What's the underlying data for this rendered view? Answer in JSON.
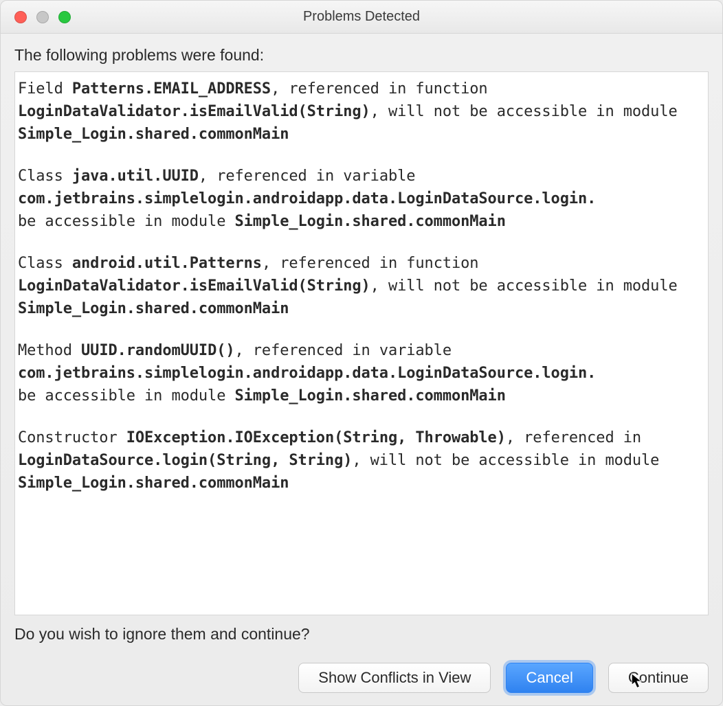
{
  "titlebar": {
    "title": "Problems Detected"
  },
  "intro": "The following problems were found:",
  "problems": [
    {
      "prefix": "Field ",
      "ref": "Patterns.EMAIL_ADDRESS",
      "mid1": ", referenced in function ",
      "func": "LoginDataValidator.isEmailValid(String)",
      "mid2": ", will not be accessible in module ",
      "module": "Simple_Login.shared.commonMain"
    },
    {
      "prefix": "Class ",
      "ref": "java.util.UUID",
      "mid1": ", referenced in variable ",
      "func": "com.jetbrains.simplelogin.androidapp.data.LoginDataSource.login.",
      "mid2": "be accessible in module ",
      "module": "Simple_Login.shared.commonMain"
    },
    {
      "prefix": "Class ",
      "ref": "android.util.Patterns",
      "mid1": ", referenced in function ",
      "func": "LoginDataValidator.isEmailValid(String)",
      "mid2": ", will not be accessible in module ",
      "module": "Simple_Login.shared.commonMain"
    },
    {
      "prefix": "Method ",
      "ref": "UUID.randomUUID()",
      "mid1": ", referenced in variable ",
      "func": "com.jetbrains.simplelogin.androidapp.data.LoginDataSource.login.",
      "mid2": "be accessible in module ",
      "module": "Simple_Login.shared.commonMain"
    },
    {
      "prefix": "Constructor ",
      "ref": "IOException.IOException(String, Throwable)",
      "mid1": ", referenced in ",
      "func": "LoginDataSource.login(String, String)",
      "mid2": ", will not be accessible in module ",
      "module": "Simple_Login.shared.commonMain"
    }
  ],
  "confirm": "Do you wish to ignore them and continue?",
  "buttons": {
    "showConflicts": "Show Conflicts in View",
    "cancel": "Cancel",
    "continue": "Continue"
  }
}
